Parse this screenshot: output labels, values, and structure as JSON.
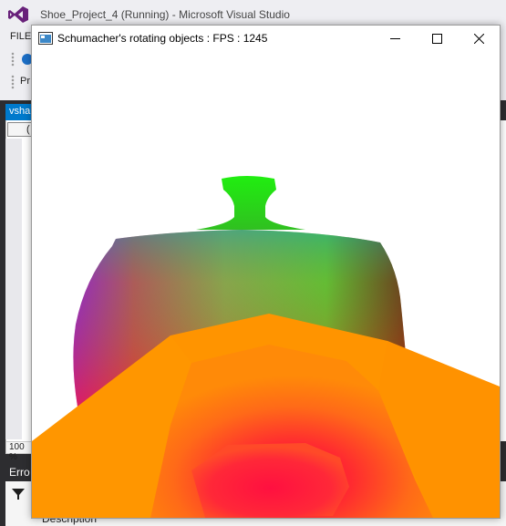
{
  "vs": {
    "title": "Shoe_Project_4 (Running) - Microsoft Visual Studio",
    "menu_first": "FILE",
    "toolbar2_text": "Pr",
    "doc_tab": "vsha",
    "line_selector": "(",
    "zoom": "100 %",
    "errors_tab": "Erro",
    "errors_column": "Description"
  },
  "gl_window": {
    "title": "Schumacher's rotating objects : FPS : 1245",
    "colors": {
      "shoe_orange": "#ff9400",
      "sole_red": "#ff1040",
      "knob_green": "#18e818",
      "body_purple": "#b000e8",
      "body_dark_red": "#800000"
    }
  }
}
